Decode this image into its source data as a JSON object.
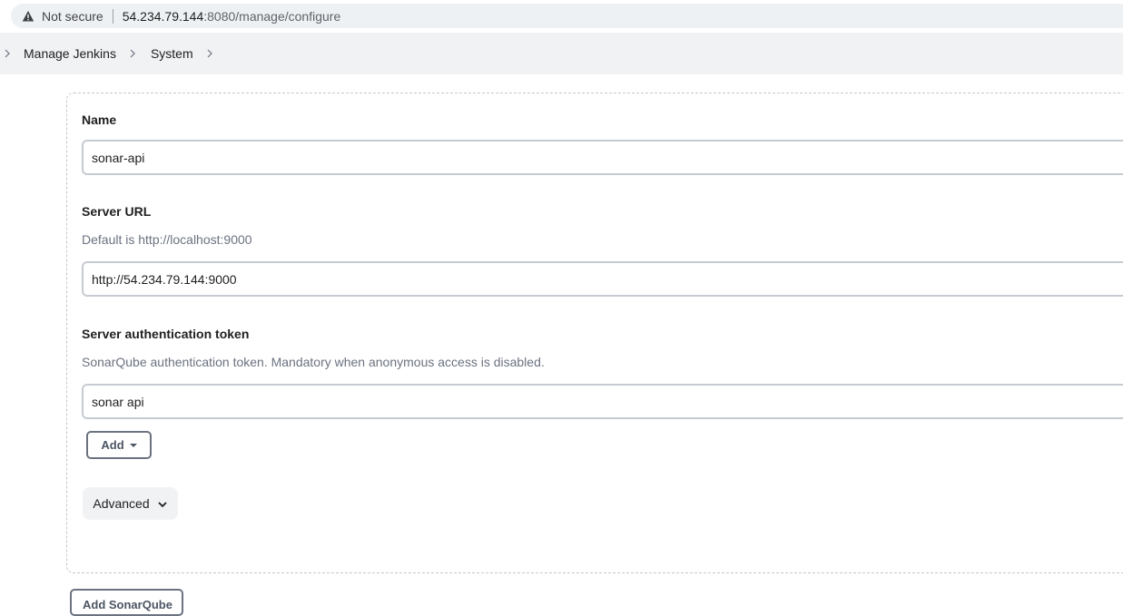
{
  "browser": {
    "security_label": "Not secure",
    "url_host": "54.234.79.144",
    "url_path": ":8080/manage/configure"
  },
  "breadcrumb": {
    "items": [
      "Manage Jenkins",
      "System"
    ]
  },
  "form": {
    "name_label": "Name",
    "name_value": "sonar-api",
    "server_url_label": "Server URL",
    "server_url_help": "Default is http://localhost:9000",
    "server_url_value": "http://54.234.79.144:9000",
    "token_label": "Server authentication token",
    "token_help": "SonarQube authentication token. Mandatory when anonymous access is disabled.",
    "token_value": "sonar api",
    "add_label": "Add",
    "advanced_label": "Advanced",
    "add_sonarqube_label": "Add SonarQube"
  },
  "icons": {
    "warning": "warning-icon",
    "chevron": "chevron-right-icon",
    "caret": "caret-down-icon",
    "advanced": "chevron-down-icon"
  }
}
